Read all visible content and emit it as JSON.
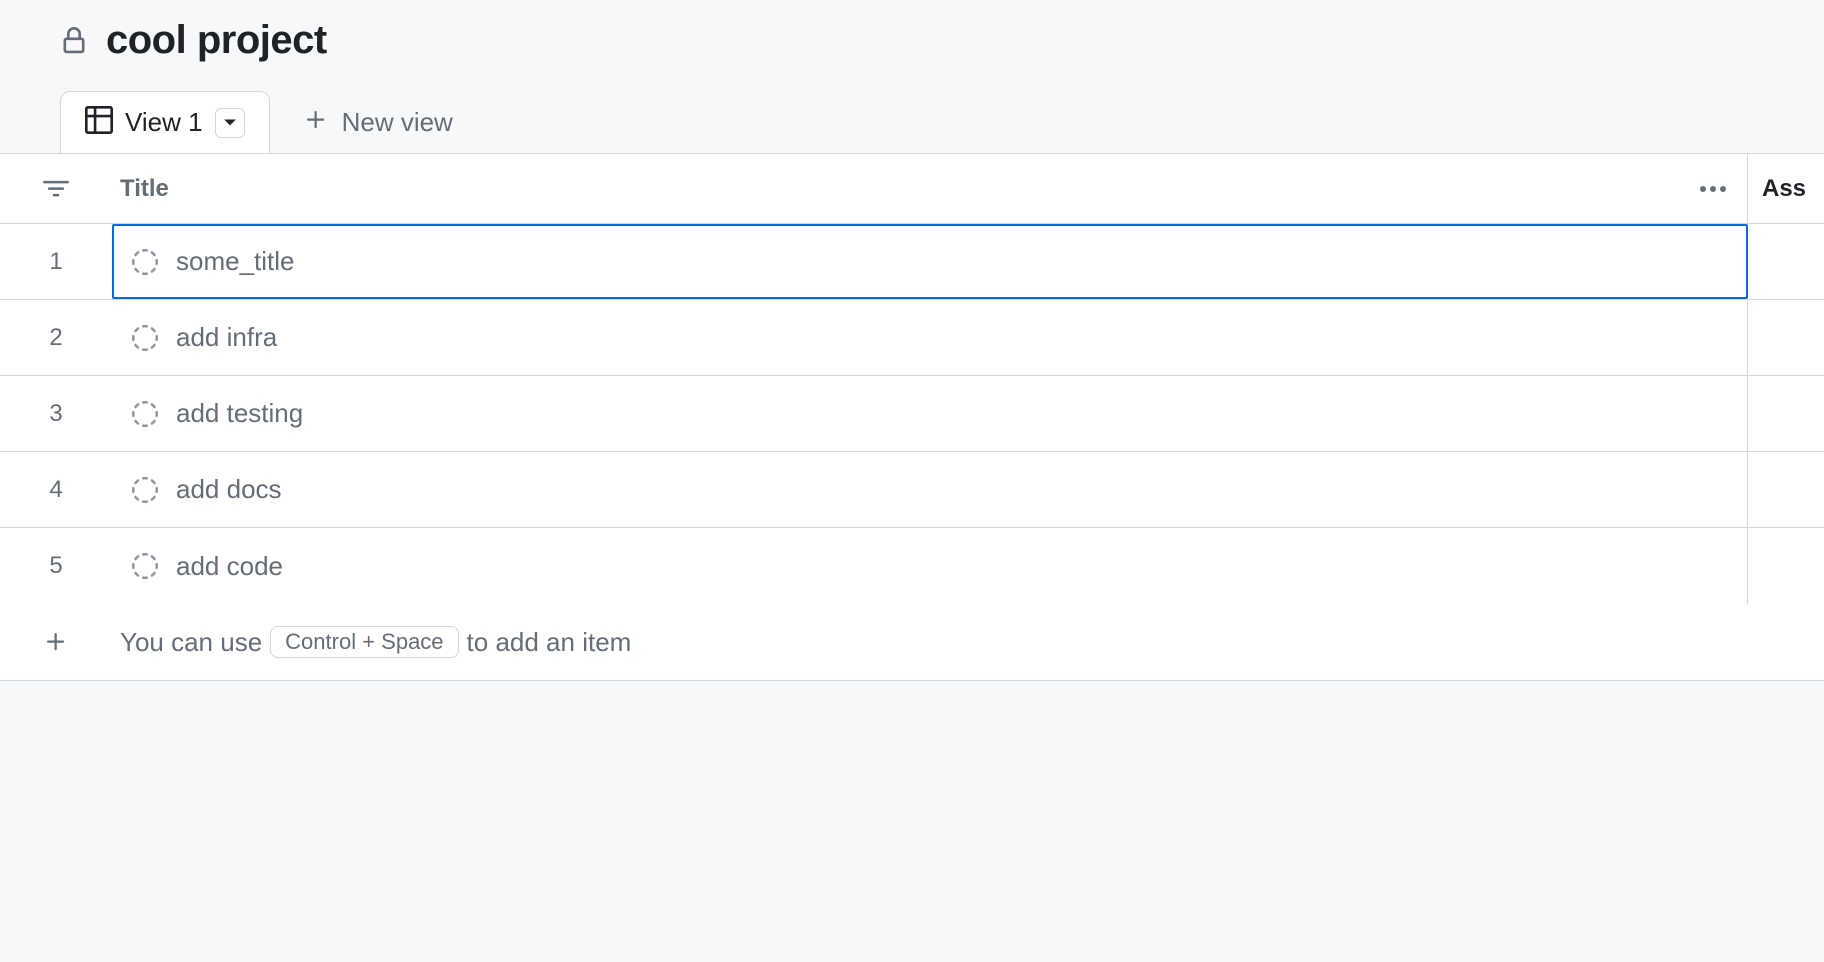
{
  "project": {
    "title": "cool project"
  },
  "tabs": {
    "active": {
      "label": "View 1"
    },
    "new_view_label": "New view"
  },
  "columns": {
    "title": "Title",
    "assignees": "Ass"
  },
  "rows": [
    {
      "num": "1",
      "title": "some_title",
      "selected": true
    },
    {
      "num": "2",
      "title": "add infra",
      "selected": false
    },
    {
      "num": "3",
      "title": "add testing",
      "selected": false
    },
    {
      "num": "4",
      "title": "add docs",
      "selected": false
    },
    {
      "num": "5",
      "title": "add code",
      "selected": false
    }
  ],
  "add_hint": {
    "pre": "You can use",
    "kbd": "Control + Space",
    "post": "to add an item"
  }
}
